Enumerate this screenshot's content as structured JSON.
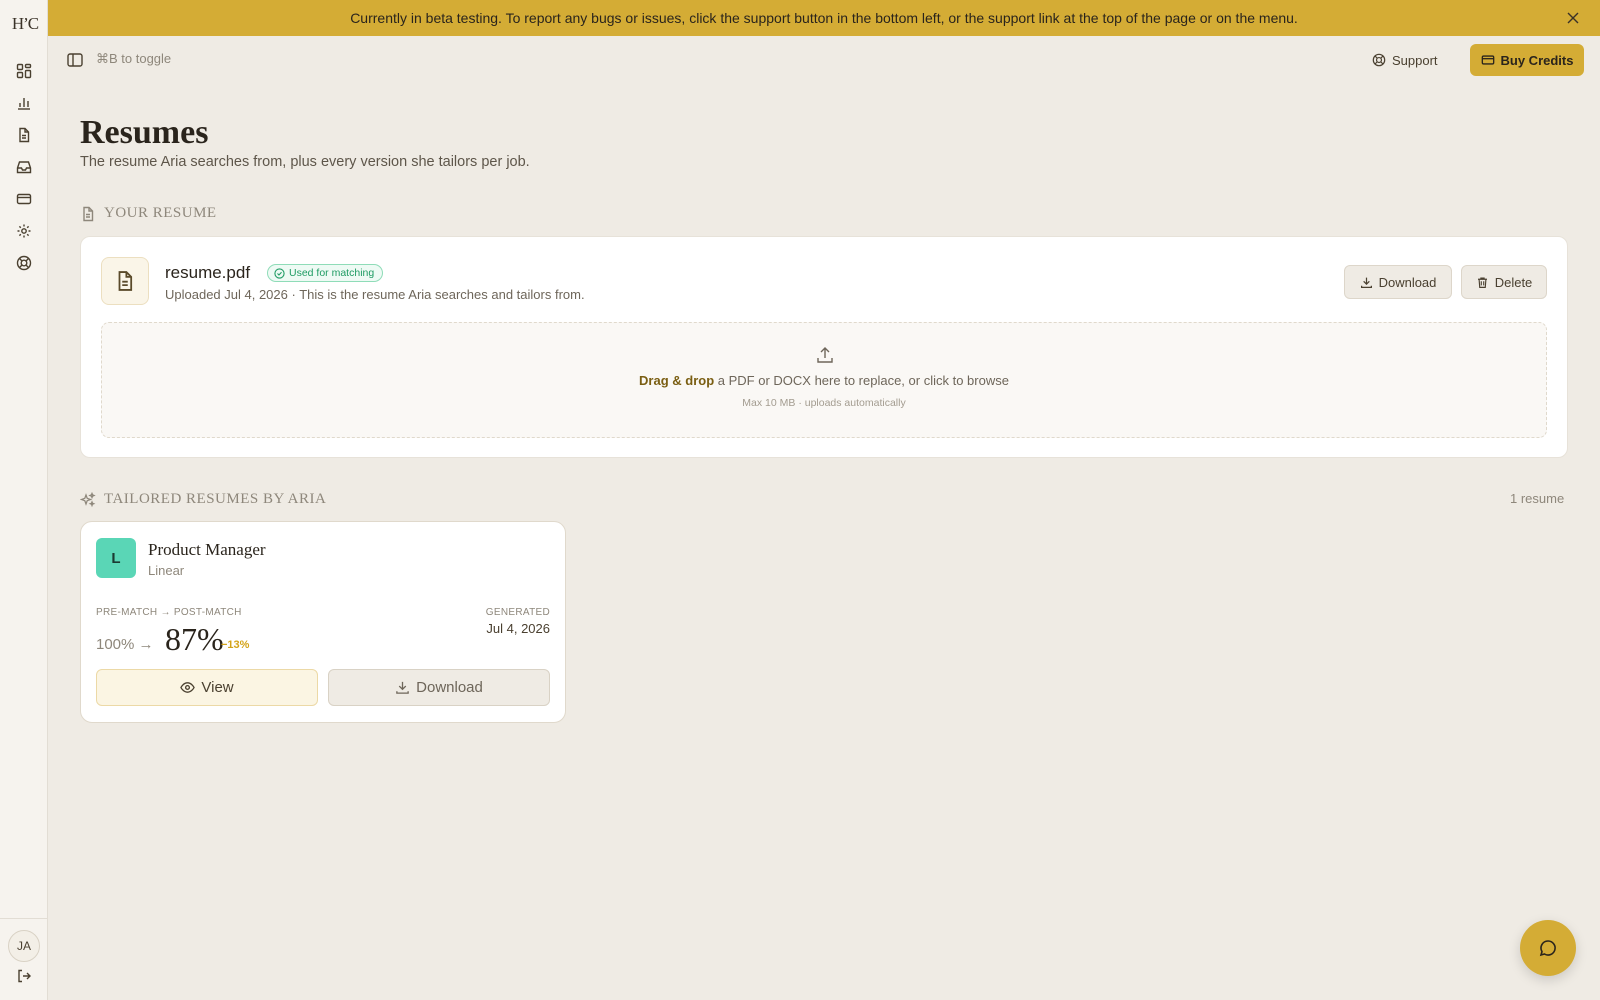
{
  "banner": {
    "text": "Currently in beta testing. To report any bugs or issues, click the support button in the bottom left, or the support link at the top of the page or on the menu."
  },
  "sidebar": {
    "logo": "H’C",
    "items": [
      {
        "icon": "dashboard-icon"
      },
      {
        "icon": "bar-chart-icon"
      },
      {
        "icon": "document-icon"
      },
      {
        "icon": "inbox-icon"
      },
      {
        "icon": "credit-card-icon"
      },
      {
        "icon": "gear-icon"
      },
      {
        "icon": "lifebuoy-icon"
      }
    ],
    "user_initials": "JA"
  },
  "topbar": {
    "toggle_hint": "⌘B to toggle",
    "support_label": "Support",
    "buy_credits_label": "Buy Credits"
  },
  "page": {
    "title": "Resumes",
    "subtitle": "The resume Aria searches from, plus every version she tailors per job."
  },
  "your_resume": {
    "section_title": "YOUR RESUME",
    "file_name": "resume.pdf",
    "badge": "Used for matching",
    "meta": "Uploaded Jul 4, 2026 · This is the resume Aria searches and tailors from.",
    "download_label": "Download",
    "delete_label": "Delete",
    "dropzone": {
      "strong": "Drag & drop",
      "text": " a PDF or DOCX here to replace, or click to browse",
      "hint": "Max 10 MB · uploads automatically"
    }
  },
  "tailored": {
    "section_title": "TAILORED RESUMES BY ARIA",
    "count_label": "1 resume",
    "items": [
      {
        "logo_letter": "L",
        "title": "Product Manager",
        "company": "Linear",
        "match_label": "PRE-MATCH → POST-MATCH",
        "pre_score": "100%",
        "arrow": "→",
        "post_score": "87%",
        "delta": "−13%",
        "generated_label": "GENERATED",
        "generated_date": "Jul 4, 2026",
        "view_label": "View",
        "download_label": "Download"
      }
    ]
  },
  "colors": {
    "accent": "#d4ac35",
    "background": "#efebe4",
    "badge_green": "#1f9b63",
    "company_logo": "#5ad6b6"
  }
}
